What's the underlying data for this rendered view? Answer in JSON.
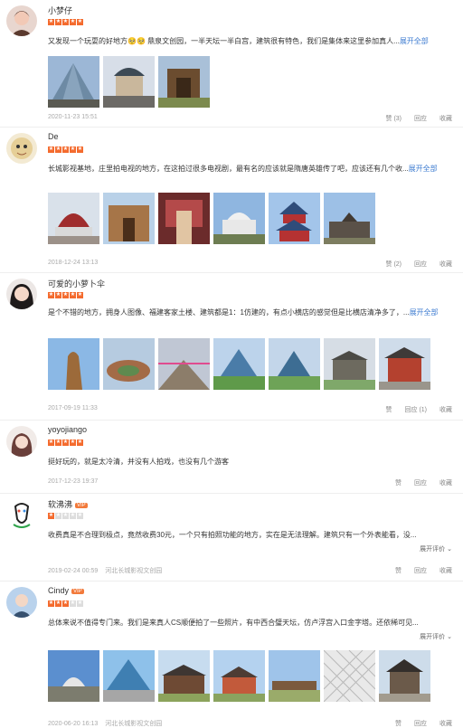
{
  "reviews": [
    {
      "username": "小梦仔",
      "badge": "",
      "stars": 5,
      "text": "又发现一个玩耍的好地方🥺🥺 鼎泉文创园，一半天坛一半白宫，建筑很有特色，我们是集体来这里参加真人...",
      "more_label": "展开全部",
      "date": "2020-11-23 15:51",
      "shop": "",
      "actions": [
        "赞 (3)",
        "回应",
        "收藏"
      ],
      "photo_count": 3
    },
    {
      "username": "De",
      "badge": "",
      "stars": 5,
      "text": "长城影视基地，庄里拍电视的地方，在这拍过很多电视剧，最有名的应该就是隋唐英雄传了吧，应该还有几个收...",
      "more_label": "展开全部",
      "date": "2018-12-24 13:13",
      "shop": "",
      "actions": [
        "赞 (2)",
        "回应",
        "收藏"
      ],
      "photo_count": 6
    },
    {
      "username": "可爱的小萝卜伞",
      "badge": "",
      "stars": 5,
      "text": "是个不错的地方，拥身人图像、福建客家土楼、建筑都是1：1仿建的，有点小横店的感觉但是比横店清净多了，...",
      "more_label": "展开全部",
      "date": "2017-09-19 11:33",
      "shop": "",
      "actions": [
        "赞",
        "回应 (1)",
        "收藏"
      ],
      "photo_count": 7
    },
    {
      "username": "yoyojiango",
      "badge": "",
      "stars": 5,
      "text": "挺好玩的，就是太冷清，并没有人拍戏，也没有几个游客",
      "more_label": "",
      "date": "2017-12-23 19:37",
      "shop": "",
      "actions": [
        "赞",
        "回应",
        "收藏"
      ],
      "photo_count": 0
    },
    {
      "username": "软沸沸",
      "badge": "VIP",
      "stars": 1,
      "text": "收费真是不合理到极点，竟然收费30元，一个只有拍照功能的地方，实在是无法理解。建筑只有一个外表能看，没...",
      "more_label": "",
      "expand_label": "展开评价",
      "date": "2019-02-24 00:59",
      "shop": "河北长城影视文创园",
      "actions": [
        "赞",
        "回应",
        "收藏"
      ],
      "photo_count": 0
    },
    {
      "username": "Cindy",
      "badge": "VIP",
      "stars": 3,
      "text": "总体来说不值得专门来。我们是来真人CS顺便拍了一些照片，有中西合璧天坛，仿卢浮宫入口金字塔。还依稀可见...",
      "more_label": "",
      "expand_label": "展开评价",
      "date": "2020-06-20 16:13",
      "shop": "河北长城影视文创园",
      "actions": [
        "赞",
        "回应",
        "收藏"
      ],
      "photo_count": 7
    }
  ]
}
